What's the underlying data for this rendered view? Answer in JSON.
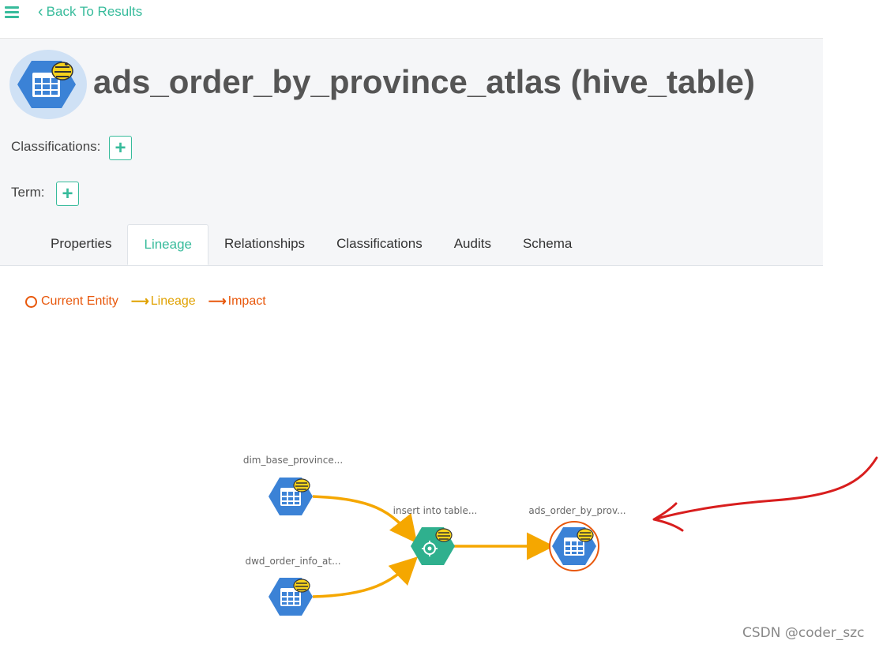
{
  "nav": {
    "back_label": "Back To Results"
  },
  "entity": {
    "title": "ads_order_by_province_atlas (hive_table)"
  },
  "fields": {
    "classifications_label": "Classifications:",
    "term_label": "Term:",
    "add_symbol": "+"
  },
  "tabs": [
    {
      "label": "Properties",
      "active": false
    },
    {
      "label": "Lineage",
      "active": true
    },
    {
      "label": "Relationships",
      "active": false
    },
    {
      "label": "Classifications",
      "active": false
    },
    {
      "label": "Audits",
      "active": false
    },
    {
      "label": "Schema",
      "active": false
    }
  ],
  "legend": {
    "current_entity": "Current Entity",
    "lineage": "Lineage",
    "impact": "Impact",
    "colors": {
      "current": "#e8580c",
      "lineage": "#f5a700",
      "impact": "#e8580c"
    }
  },
  "lineage": {
    "nodes": [
      {
        "id": "dim",
        "label": "dim_base_province...",
        "type": "hive_table"
      },
      {
        "id": "dwd",
        "label": "dwd_order_info_at...",
        "type": "hive_table"
      },
      {
        "id": "proc",
        "label": "insert into table...",
        "type": "hive_process"
      },
      {
        "id": "ads",
        "label": "ads_order_by_prov...",
        "type": "hive_table",
        "current": true
      }
    ],
    "edges": [
      {
        "from": "dim",
        "to": "proc"
      },
      {
        "from": "dwd",
        "to": "proc"
      },
      {
        "from": "proc",
        "to": "ads"
      }
    ]
  },
  "watermark": "CSDN @coder_szc"
}
